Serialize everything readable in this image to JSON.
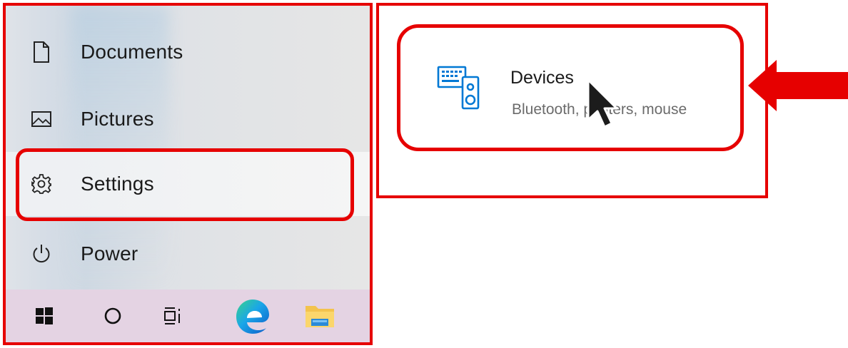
{
  "start_menu": {
    "items": [
      {
        "label": "Documents",
        "icon": "document-icon"
      },
      {
        "label": "Pictures",
        "icon": "pictures-icon"
      },
      {
        "label": "Settings",
        "icon": "gear-icon"
      },
      {
        "label": "Power",
        "icon": "power-icon"
      }
    ]
  },
  "taskbar": {
    "buttons": [
      {
        "icon": "windows-logo-icon"
      },
      {
        "icon": "search-circle-icon"
      },
      {
        "icon": "task-view-icon"
      },
      {
        "icon": "edge-browser-icon"
      },
      {
        "icon": "file-explorer-icon"
      }
    ]
  },
  "settings_panel": {
    "devices": {
      "title": "Devices",
      "subtitle": "Bluetooth, printers, mouse",
      "icon": "devices-icon"
    }
  },
  "colors": {
    "highlight_red": "#e60000",
    "accent_blue": "#0078d4",
    "taskbar": "#e4d3e3"
  }
}
